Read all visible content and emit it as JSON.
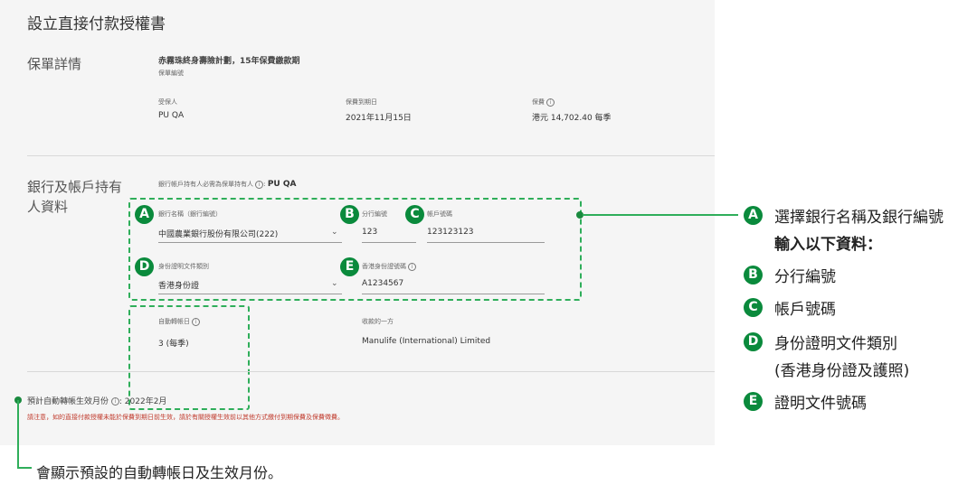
{
  "form": {
    "title": "設立直接付款授權書",
    "policy_section": {
      "heading": "保單詳情",
      "plan_name": "赤霧珠終身壽險計劃，15年保費繳款期",
      "policy_number_label": "保單編號",
      "insured_label": "受保人",
      "insured_value": "PU QA",
      "due_date_label": "保費到期日",
      "due_date_value": "2021年11月15日",
      "premium_label": "保費",
      "premium_value": "港元 14,702.40 每季"
    },
    "bank_section": {
      "heading_line1": "銀行及帳戶持有",
      "heading_line2": "人資料",
      "holder_note": "銀行帳戶持有人必需為保單持有人",
      "holder_value": "PU QA",
      "bank_name_label": "銀行名稱（銀行編號）",
      "bank_name_value": "中國農業銀行股份有限公司(222)",
      "branch_label": "分行編號",
      "branch_value": "123",
      "account_label": "帳戶號碼",
      "account_value": "123123123",
      "id_type_label": "身份證明文件類別",
      "id_type_value": "香港身份證",
      "id_number_label": "香港身份證號碼",
      "id_number_value": "A1234567",
      "auto_transfer_day_label": "自動轉帳日",
      "auto_transfer_day_value": "3 (每季)",
      "payee_label": "收款的一方",
      "payee_value": "Manulife (International) Limited"
    },
    "effective_month_label": "預計自動轉帳生效月份",
    "effective_month_value": "2022年2月",
    "warning_text": "請注意，如的直接付款授權未能於保費到期日前生效，請於有關授權生效前以其他方式繳付到期保費及保費徵費。"
  },
  "badges": {
    "a": "A",
    "b": "B",
    "c": "C",
    "d": "D",
    "e": "E"
  },
  "annotations": {
    "line1": "選擇銀行名稱及銀行編號",
    "line2": "輸入以下資料：",
    "b_text": "分行編號",
    "c_text": "帳戶號碼",
    "d_text": "身份證明文件類別",
    "d_text2": "(香港身份證及護照)",
    "e_text": "證明文件號碼",
    "bottom_note": "會顯示預設的自動轉帳日及生效月份。"
  },
  "icons": {
    "info": "info-circle-icon",
    "chevron": "chevron-down-icon"
  },
  "colors": {
    "accent_green": "#0a8a3c",
    "dashed_green": "#2fae5a",
    "warning_red": "#c0392b",
    "panel_bg": "#f5f5f5"
  }
}
